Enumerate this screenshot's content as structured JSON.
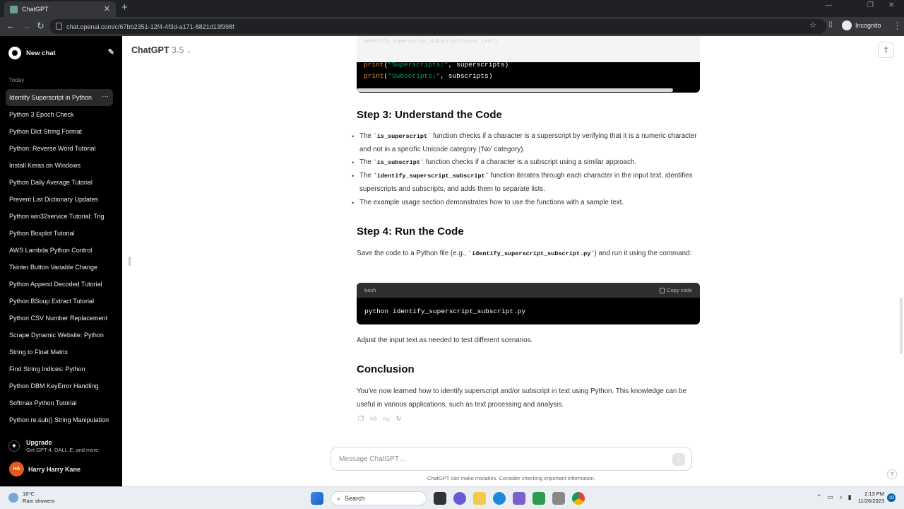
{
  "browser": {
    "tab_title": "ChatGPT",
    "url": "chat.openai.com/c/67bb2351-12f4-4f3d-a171-8821d13f998f",
    "mode_label": "Incognito"
  },
  "sidebar": {
    "new_chat": "New chat",
    "section_label": "Today",
    "items": [
      {
        "label": "Identify Superscript in Python"
      },
      {
        "label": "Python 3 Epoch Check"
      },
      {
        "label": "Python Dict String Format"
      },
      {
        "label": "Python: Reverse Word Tutorial"
      },
      {
        "label": "Install Keras on Windows"
      },
      {
        "label": "Python Daily Average Tutorial"
      },
      {
        "label": "Prevent List Dictionary Updates"
      },
      {
        "label": "Python win32service Tutorial: Trig"
      },
      {
        "label": "Python Boxplot Tutorial"
      },
      {
        "label": "AWS Lambda Python Control"
      },
      {
        "label": "Tkinter Button Variable Change"
      },
      {
        "label": "Python Append Decoded Tutorial"
      },
      {
        "label": "Python BSoup Extract Tutorial"
      },
      {
        "label": "Python CSV Number Replacement"
      },
      {
        "label": "Scrape Dynamic Website: Python"
      },
      {
        "label": "String to Float Matrix"
      },
      {
        "label": "Find String Indices: Python"
      },
      {
        "label": "Python DBM KeyError Handling"
      },
      {
        "label": "Softmax Python Tutorial"
      },
      {
        "label": "Python re.sub() String Manipulation"
      }
    ],
    "upgrade_title": "Upgrade",
    "upgrade_subtitle": "Get GPT-4, DALL·E, and more",
    "user_initials": "HA",
    "user_name": "Harry Harry Kane"
  },
  "header": {
    "model_name": "ChatGPT",
    "model_version": "3.5"
  },
  "content": {
    "code_tail": {
      "faded_line": "identify_superscript_subscript(input_text)",
      "line1_fn": "print",
      "line1_str": "\"Superscripts:\"",
      "line1_rest": ", superscripts)",
      "line2_fn": "print",
      "line2_str": "\"Subscripts:\"",
      "line2_rest": ", subscripts)"
    },
    "step3_heading": "Step 3: Understand the Code",
    "step3_bullets": [
      {
        "pre": "The ",
        "code": "`is_superscript`",
        "post": " function checks if a character is a superscript by verifying that it is a numeric character and not in a specific Unicode category ('No' category)."
      },
      {
        "pre": "The ",
        "code": "`is_subscript`",
        "post": " function checks if a character is a subscript using a similar approach."
      },
      {
        "pre": "The ",
        "code": "`identify_superscript_subscript`",
        "post": " function iterates through each character in the input text, identifies superscripts and subscripts, and adds them to separate lists."
      },
      {
        "pre": "",
        "code": "",
        "post": "The example usage section demonstrates how to use the functions with a sample text."
      }
    ],
    "step4_heading": "Step 4: Run the Code",
    "step4_pre": "Save the code to a Python file (e.g., ",
    "step4_code": "`identify_superscript_subscript.py`",
    "step4_post": ") and run it using the command:",
    "bash_lang": "bash",
    "copy_code": "Copy code",
    "bash_command": "python identify_superscript_subscript.py",
    "adjust_text": "Adjust the input text as needed to test different scenarios.",
    "conclusion_heading": "Conclusion",
    "conclusion_text": "You've now learned how to identify superscript and/or subscript in text using Python. This knowledge can be useful in various applications, such as text processing and analysis."
  },
  "composer": {
    "placeholder": "Message ChatGPT…",
    "disclaimer": "ChatGPT can make mistakes. Consider checking important information.",
    "help": "?"
  },
  "taskbar": {
    "temperature": "18°C",
    "weather": "Rain showers",
    "search_label": "Search",
    "time": "2:13 PM",
    "date": "11/26/2023",
    "notification_count": "10"
  }
}
